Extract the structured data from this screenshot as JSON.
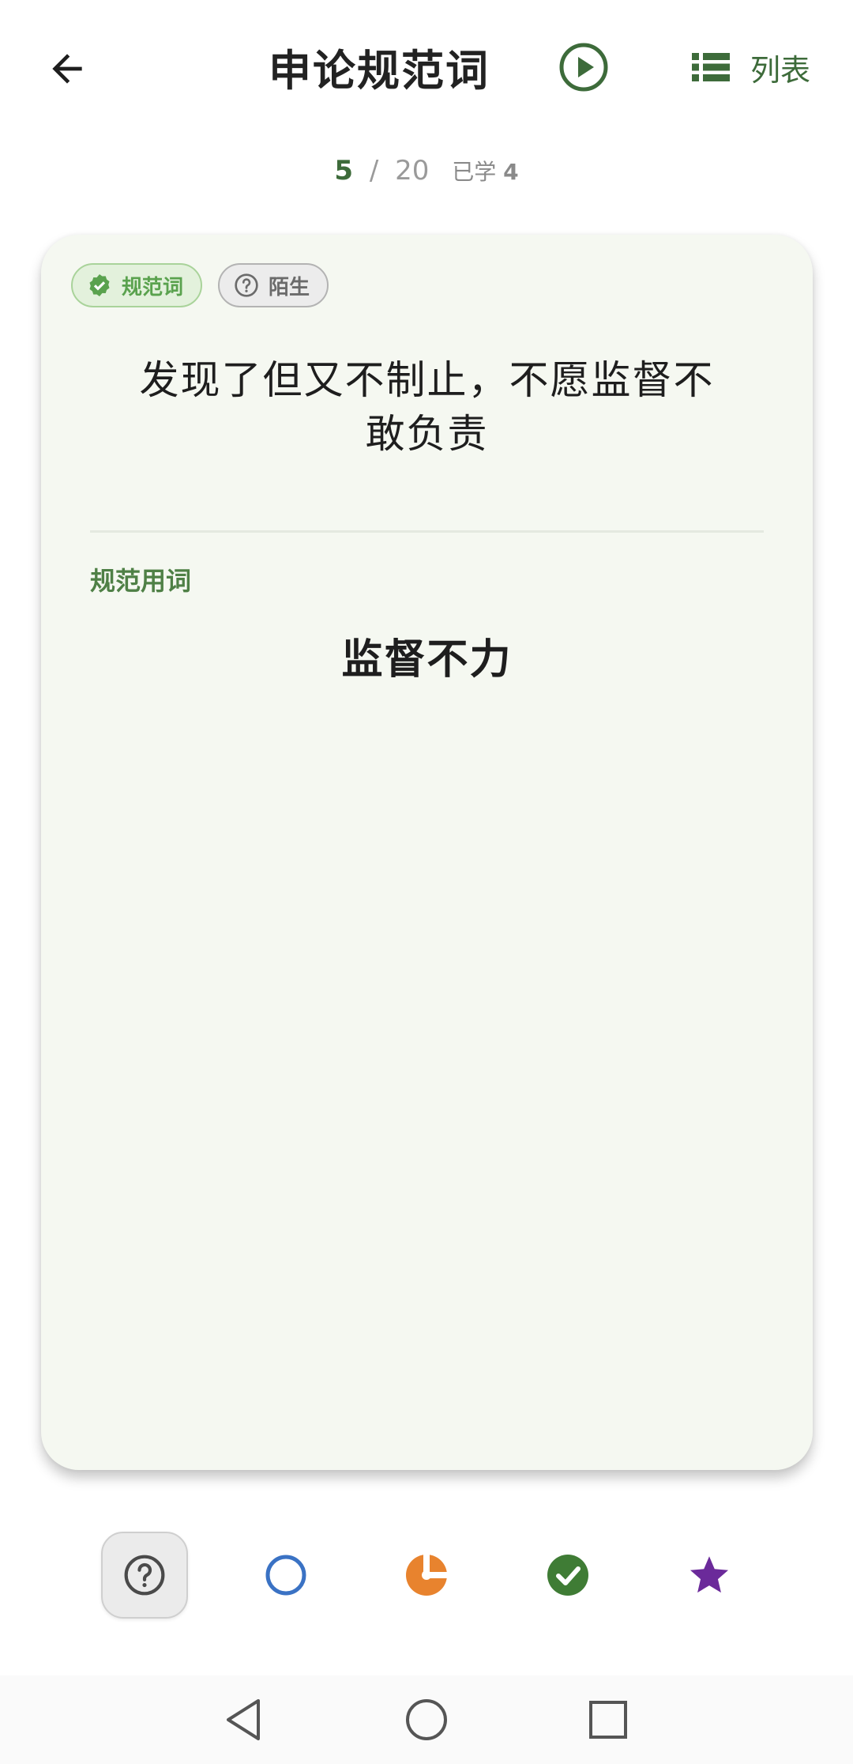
{
  "header": {
    "title": "申论规范词",
    "list_label": "列表",
    "back_icon": "arrow-left-icon",
    "play_icon": "play-circle-icon",
    "list_icon": "list-icon"
  },
  "progress": {
    "current": "5",
    "separator": "/",
    "total": "20",
    "learned_label": "已学",
    "learned_count": "4"
  },
  "card": {
    "badges": [
      {
        "label": "规范词",
        "icon": "check-badge-icon"
      },
      {
        "label": "陌生",
        "icon": "question-circle-icon"
      }
    ],
    "phrase": "发现了但又不制止，不愿监督不敢负责",
    "section_label": "规范用词",
    "answer": "监督不力"
  },
  "status_buttons": [
    {
      "icon": "question-circle-icon",
      "selected": true
    },
    {
      "icon": "empty-circle-icon",
      "color": "#3a72c4"
    },
    {
      "icon": "half-circle-icon",
      "color": "#e8832e"
    },
    {
      "icon": "check-circle-icon",
      "color": "#3f7c35"
    },
    {
      "icon": "star-icon",
      "color": "#6b2a9a"
    }
  ],
  "colors": {
    "accent": "#3d6b3a",
    "card_bg": "#f5f8f1",
    "badge_green": "#5aa24e"
  }
}
